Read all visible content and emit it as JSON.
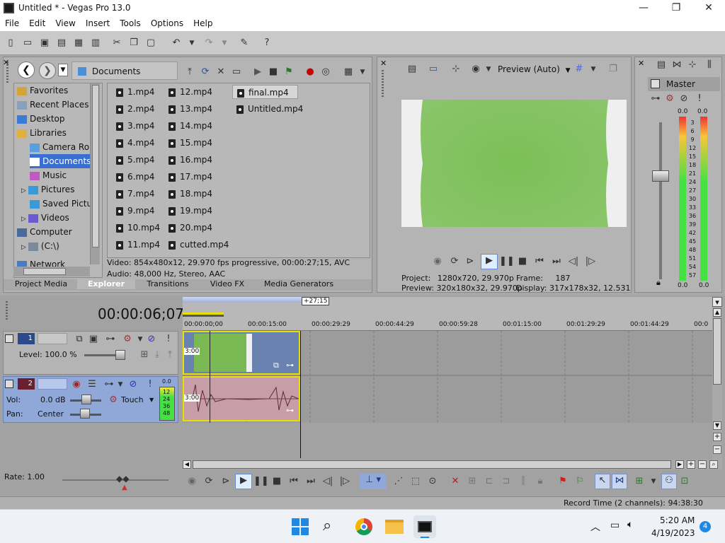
{
  "window": {
    "title": "Untitled * - Vegas Pro 13.0"
  },
  "menu": [
    "File",
    "Edit",
    "View",
    "Insert",
    "Tools",
    "Options",
    "Help"
  ],
  "explorer": {
    "location": "Documents",
    "tree": [
      "Favorites",
      "Recent Places",
      "Desktop",
      "Libraries",
      "Camera Roll",
      "Documents",
      "Music",
      "Pictures",
      "Saved Pictur",
      "Videos",
      "Computer",
      "(C:\\)",
      "Network"
    ],
    "files_col1": [
      "1.mp4",
      "2.mp4",
      "3.mp4",
      "4.mp4",
      "5.mp4",
      "6.mp4",
      "7.mp4",
      "9.mp4",
      "10.mp4",
      "11.mp4"
    ],
    "files_col2": [
      "12.mp4",
      "13.mp4",
      "14.mp4",
      "15.mp4",
      "16.mp4",
      "17.mp4",
      "18.mp4",
      "19.mp4",
      "20.mp4",
      "cutted.mp4"
    ],
    "files_col3": [
      "final.mp4",
      "Untitled.mp4"
    ],
    "info_video": "Video: 854x480x12, 29.970 fps progressive, 00:00:27;15, AVC",
    "info_audio": "Audio: 48,000 Hz, Stereo, AAC",
    "tabs": [
      "Project Media",
      "Explorer",
      "Transitions",
      "Video FX",
      "Media Generators"
    ]
  },
  "preview": {
    "mode": "Preview (Auto)",
    "project_label": "Project:",
    "project_value": "1280x720, 29.970p",
    "frame_label": "Frame:",
    "frame_value": "187",
    "preview_label": "Preview:",
    "preview_value": "320x180x32, 29.970p",
    "display_label": "Display:",
    "display_value": "317x178x32, 12.531"
  },
  "master": {
    "label": "Master",
    "left_peak": "0.0",
    "right_peak": "0.0",
    "bottom_left": "0.0",
    "bottom_right": "0.0",
    "ticks": [
      "3",
      "6",
      "9",
      "12",
      "15",
      "18",
      "21",
      "24",
      "27",
      "30",
      "33",
      "36",
      "39",
      "42",
      "45",
      "48",
      "51",
      "54",
      "57"
    ]
  },
  "timeline": {
    "time": "00:00:06;07",
    "loop_length": "+27;15",
    "ruler": [
      "00:00:00;00",
      "00:00:15:00",
      "00:00:29:29",
      "00:00:44:29",
      "00:00:59:28",
      "00:01:15:00",
      "00:01:29:29",
      "00:01:44:29",
      "00:0"
    ],
    "video_track": {
      "number": "1",
      "level": "Level: 100.0 %",
      "fade": "3:00"
    },
    "audio_track": {
      "number": "2",
      "vol_label": "Vol:",
      "vol_value": "0.0 dB",
      "pan_label": "Pan:",
      "pan_value": "Center",
      "mode": "Touch",
      "meter_peak": "0.0",
      "meter_ticks": [
        "12",
        "24",
        "36",
        "48"
      ],
      "fade": "3:00"
    },
    "rate": "Rate: 1.00"
  },
  "status": {
    "record_time": "Record Time (2 channels): 94:38:30"
  },
  "taskbar": {
    "time": "5:20 AM",
    "date": "4/19/2023",
    "badge": "4"
  },
  "colors": {
    "accent": "#3399ff",
    "clip_video": "#6aa84f",
    "clip_audio": "#c39aa2",
    "selection": "#4d7cd6"
  }
}
